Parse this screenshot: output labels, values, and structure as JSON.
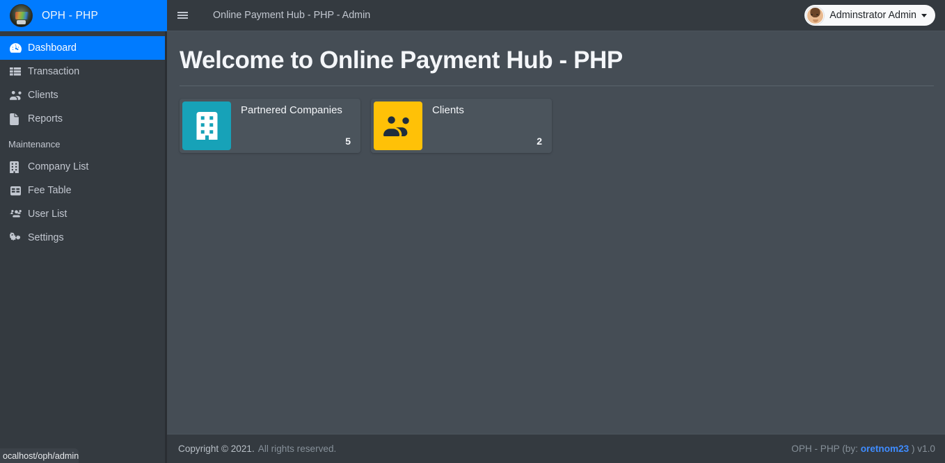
{
  "brand": {
    "text": "OPH - PHP",
    "logo_icon": "app-logo-avatar"
  },
  "sidebar": {
    "items": [
      {
        "label": "Dashboard",
        "icon": "tachometer-icon",
        "active": true
      },
      {
        "label": "Transaction",
        "icon": "table-list-icon",
        "active": false
      },
      {
        "label": "Clients",
        "icon": "users-two-icon",
        "active": false
      },
      {
        "label": "Reports",
        "icon": "file-icon",
        "active": false
      }
    ],
    "section_header": "Maintenance",
    "maintenance_items": [
      {
        "label": "Company List",
        "icon": "building-icon",
        "active": false
      },
      {
        "label": "Fee Table",
        "icon": "table-grid-icon",
        "active": false
      },
      {
        "label": "User List",
        "icon": "users-three-icon",
        "active": false
      },
      {
        "label": "Settings",
        "icon": "cogs-icon",
        "active": false
      }
    ]
  },
  "topbar": {
    "menu_icon": "hamburger-icon",
    "title": "Online Payment Hub - PHP - Admin",
    "user_name": "Adminstrator Admin",
    "user_avatar_icon": "user-avatar",
    "caret_icon": "caret-down-icon"
  },
  "content": {
    "page_title": "Welcome to Online Payment Hub - PHP",
    "cards": [
      {
        "label": "Partnered Companies",
        "value": "5",
        "icon": "building-icon",
        "color": "#17a2b8"
      },
      {
        "label": "Clients",
        "value": "2",
        "icon": "users-two-icon",
        "color": "#ffc107"
      }
    ]
  },
  "footer": {
    "copyright_strong": "Copyright © 2021.",
    "copyright_dim": "All rights reserved.",
    "right_prefix": "OPH - PHP (by:",
    "right_link": "oretnom23",
    "right_suffix": ") v1.0"
  },
  "status_tip": {
    "url": "ocalhost/oph/admin"
  },
  "colors": {
    "sidebar_bg": "#343a40",
    "content_bg": "#454d55",
    "accent_blue": "#007bff",
    "card_bg": "#4b545c",
    "teal": "#17a2b8",
    "amber": "#ffc107",
    "link_blue": "#3f8cff"
  }
}
